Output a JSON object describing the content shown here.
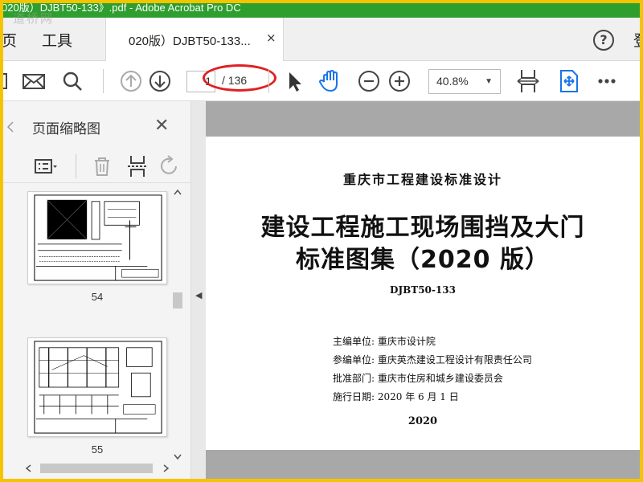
{
  "window": {
    "title": "020版）DJBT50-133》.pdf - Adobe Acrobat Pro DC",
    "watermark": "道桥网"
  },
  "menu": {
    "page_partial": "页",
    "tools": "工具",
    "login_partial": "登"
  },
  "tab": {
    "label": "020版）DJBT50-133...",
    "close": "×"
  },
  "toolbar": {
    "current_page": "1",
    "total_pages": "/ 136",
    "zoom": "40.8%",
    "zoom_arrow": "▼",
    "highlight_color": "#e02020"
  },
  "sidepanel": {
    "title": "页面缩略图",
    "close": "✕",
    "thumbnails": [
      {
        "page": "54"
      },
      {
        "page": "55"
      }
    ]
  },
  "document": {
    "org": "重庆市工程建设标准设计",
    "title_line1": "建设工程施工现场围挡及大门",
    "title_line2": "标准图集（2020 版）",
    "code": "DJBT50-133",
    "info": [
      "主编单位: 重庆市设计院",
      "参编单位: 重庆英杰建设工程设计有限责任公司",
      "批准部门: 重庆市住房和城乡建设委员会",
      "施行日期: 2020 年 6 月 1 日"
    ],
    "year": "2020"
  },
  "colors": {
    "frame": "#f5c400",
    "titlebar": "#2e9e2e",
    "accent_blue": "#1a73e8"
  }
}
